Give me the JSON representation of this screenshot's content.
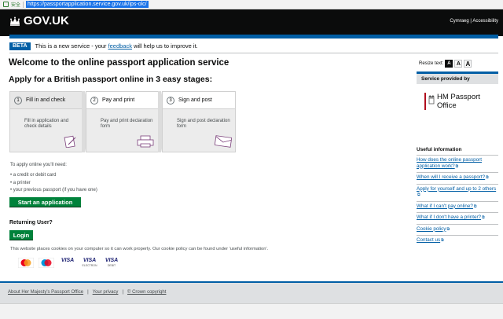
{
  "browser": {
    "security_label": "安全",
    "url": "https://passportapplication.service.gov.uk/ips-olc/"
  },
  "header": {
    "logo": "GOV.UK",
    "cymraeg": "Cymraeg",
    "accessibility": "Accessibility"
  },
  "beta": {
    "tag": "BETA",
    "text_before": "This is a new service - your",
    "feedback_link": "feedback",
    "text_after": "will help us to improve it."
  },
  "main": {
    "title": "Welcome to the online passport application service",
    "subtitle": "Apply for a British passport online in 3 easy stages:",
    "stages": [
      {
        "num": "1",
        "title": "Fill in and check",
        "desc": "Fill in application and check details",
        "icon": "form-pen-icon"
      },
      {
        "num": "2",
        "title": "Pay and print",
        "desc": "Pay and print declaration form",
        "icon": "printer-icon"
      },
      {
        "num": "3",
        "title": "Sign and post",
        "desc": "Sign and post declaration form",
        "icon": "envelope-icon"
      }
    ],
    "need_intro": "To apply online you'll need:",
    "needs": [
      "a credit or debit card",
      "a printer",
      "your previous passport (if you have one)"
    ],
    "start_button": "Start an application",
    "returning": "Returning User?",
    "login_button": "Login",
    "cookies": "This website places cookies on your computer so it can work properly. Our cookie policy can be found under 'useful information'.",
    "cards": {
      "visa": "VISA",
      "visa_electron_sub": "ELECTRON",
      "visa_debit_sub": "DEBIT"
    }
  },
  "sidebar": {
    "resize_label": "Resize text:",
    "resize_options": [
      "A",
      "A",
      "A"
    ],
    "provided_by": "Service provided by",
    "org_line1": "HM Passport",
    "org_line2": "Office",
    "useful_title": "Useful information",
    "links": [
      "How does the online passport application work?",
      "When will I receive a passport?",
      "Apply for yourself and up to 2 others",
      "What if I can't pay online?",
      "What if I don't have a printer?",
      "Cookie policy",
      "Contact us"
    ]
  },
  "footer": {
    "links": [
      "About Her Majesty's Passport Office",
      "Your privacy",
      "© Crown copyright"
    ],
    "sep": "|"
  },
  "colors": {
    "gov_black": "#0b0c0c",
    "gov_blue": "#005ea5",
    "button_green": "#00823b",
    "link_blue": "#005ea5"
  }
}
